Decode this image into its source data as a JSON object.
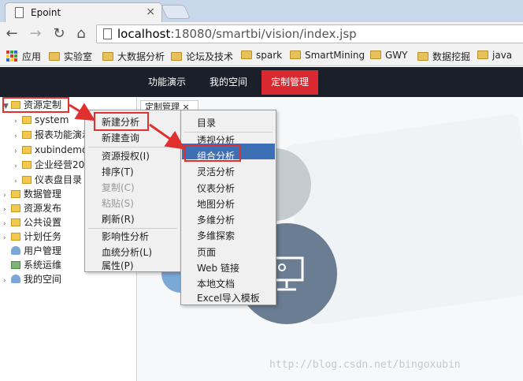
{
  "browser": {
    "tab_title": "Epoint",
    "url_host": "localhost",
    "url_rest": ":18080/smartbi/vision/index.jsp"
  },
  "bookmarks": [
    "应用",
    "实验室",
    "大数据分析",
    "论坛及技术",
    "spark",
    "SmartMining",
    "GWY",
    "数据挖掘",
    "java"
  ],
  "app_nav": {
    "items": [
      "功能演示",
      "我的空间",
      "定制管理"
    ],
    "active_index": 2,
    "active_color": "#d9282f"
  },
  "tree": {
    "root": "资源定制",
    "children": [
      "system",
      "报表功能演示",
      "xubindemo",
      "企业经营20",
      "仪表盘目录"
    ],
    "others": [
      "数据管理",
      "资源发布",
      "公共设置",
      "计划任务",
      "用户管理",
      "系统运维",
      "我的空间"
    ]
  },
  "content": {
    "tab_label": "定制管理"
  },
  "context_menu": {
    "items": [
      "新建分析",
      "新建查询",
      "资源授权(I)",
      "排序(T)",
      "复制(C)",
      "粘贴(S)",
      "刷新(R)",
      "影响性分析",
      "血统分析(L)",
      "属性(P)"
    ],
    "disabled": [
      "复制(C)",
      "粘贴(S)"
    ]
  },
  "submenu": {
    "items": [
      "目录",
      "透视分析",
      "组合分析",
      "灵活分析",
      "仪表分析",
      "地图分析",
      "多维分析",
      "多维探索",
      "页面",
      "Web 链接",
      "本地文档",
      "Excel导入模板"
    ],
    "highlighted": "组合分析"
  },
  "watermark": "http://blog.csdn.net/bingoxubin",
  "colors": {
    "annotation": "#e03030",
    "highlight": "#3d6fb5"
  }
}
